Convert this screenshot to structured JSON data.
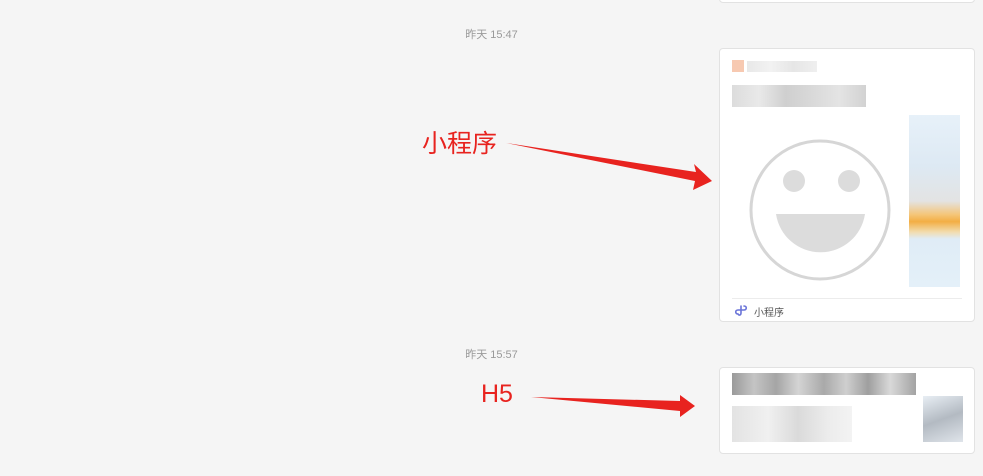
{
  "chat": {
    "timestamps": [
      "昨天 15:47",
      "昨天 15:57"
    ],
    "mini_program_card": {
      "footer_label": "小程序",
      "footer_icon": "mini-program-link-icon",
      "thumbnail_icon": "smiley-face-icon"
    },
    "h5_card": {}
  },
  "annotations": {
    "mini_program": "小程序",
    "h5": "H5",
    "color": "#e8231f"
  }
}
